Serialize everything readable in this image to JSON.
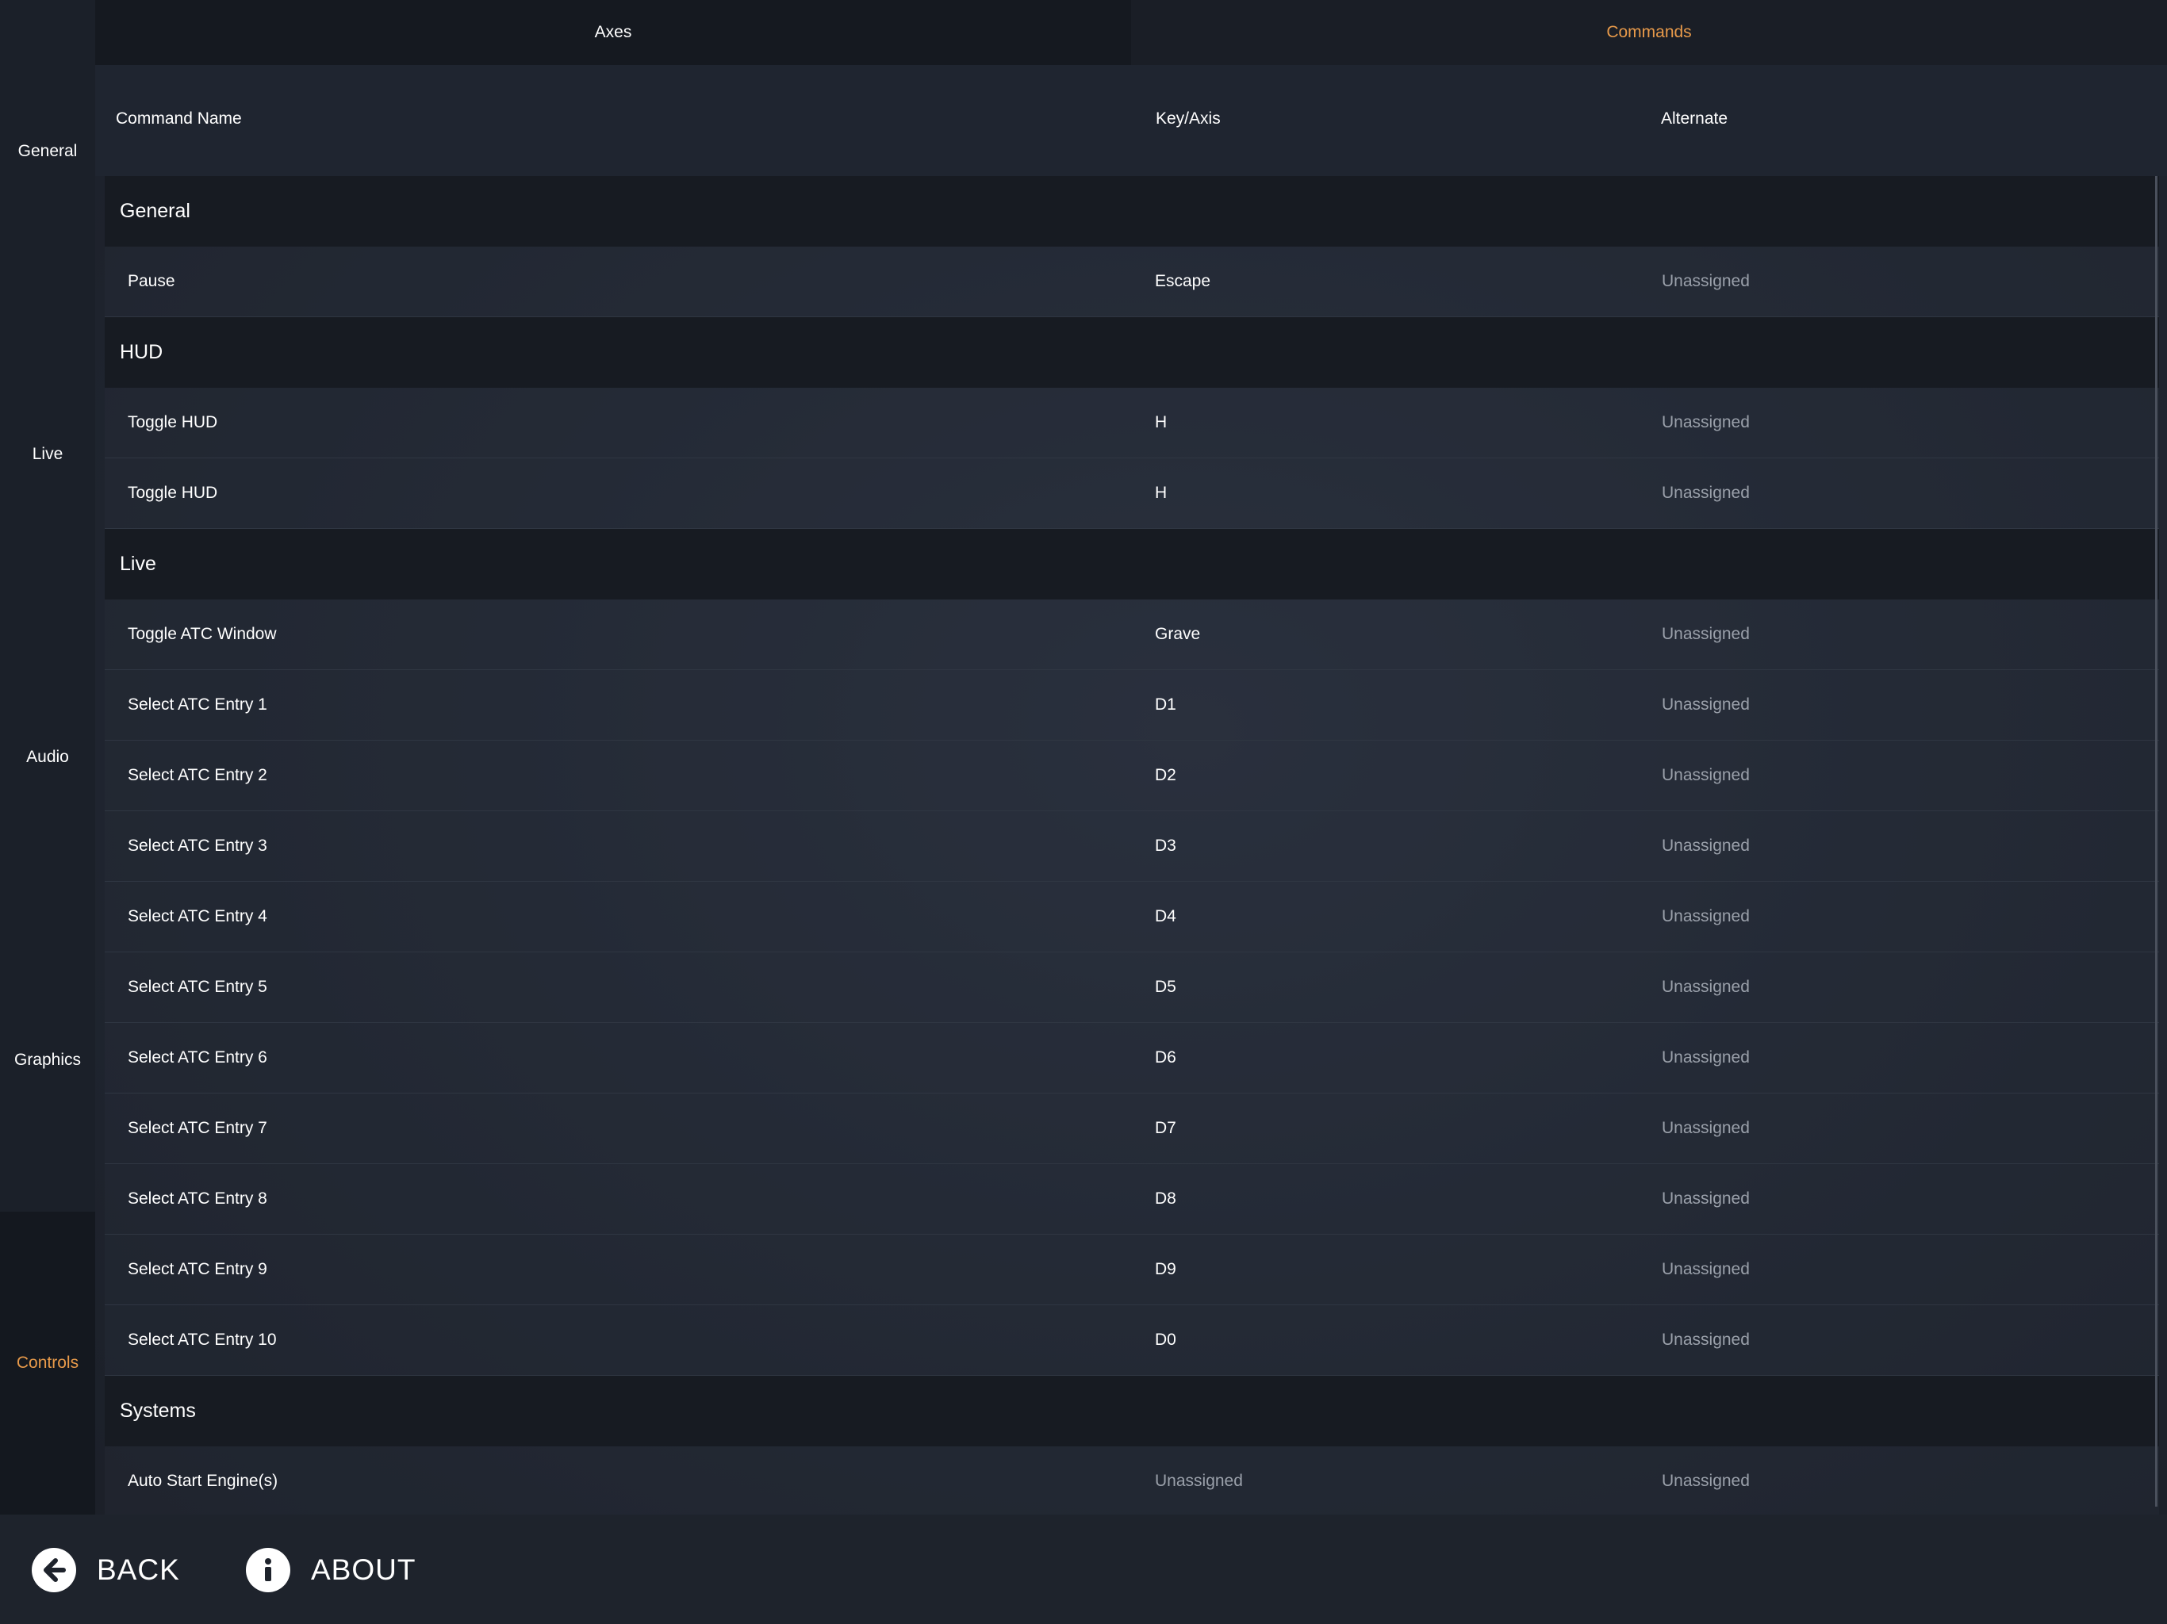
{
  "sidebar": {
    "items": [
      {
        "label": "General",
        "active": false
      },
      {
        "label": "Live",
        "active": false
      },
      {
        "label": "Audio",
        "active": false
      },
      {
        "label": "Graphics",
        "active": false
      },
      {
        "label": "Controls",
        "active": true
      }
    ]
  },
  "tabs": [
    {
      "label": "Axes",
      "active": false
    },
    {
      "label": "Commands",
      "active": true
    }
  ],
  "columns": {
    "name": "Command Name",
    "key": "Key/Axis",
    "alternate": "Alternate"
  },
  "sections": [
    {
      "title": "General",
      "rows": [
        {
          "name": "Pause",
          "key": "Escape",
          "alternate": "Unassigned"
        }
      ]
    },
    {
      "title": "HUD",
      "rows": [
        {
          "name": "Toggle HUD",
          "key": "H",
          "alternate": "Unassigned"
        },
        {
          "name": "Toggle HUD",
          "key": "H",
          "alternate": "Unassigned"
        }
      ]
    },
    {
      "title": "Live",
      "rows": [
        {
          "name": "Toggle ATC Window",
          "key": "Grave",
          "alternate": "Unassigned"
        },
        {
          "name": "Select ATC Entry 1",
          "key": "D1",
          "alternate": "Unassigned"
        },
        {
          "name": "Select ATC Entry 2",
          "key": "D2",
          "alternate": "Unassigned"
        },
        {
          "name": "Select ATC Entry 3",
          "key": "D3",
          "alternate": "Unassigned"
        },
        {
          "name": "Select ATC Entry 4",
          "key": "D4",
          "alternate": "Unassigned"
        },
        {
          "name": "Select ATC Entry 5",
          "key": "D5",
          "alternate": "Unassigned"
        },
        {
          "name": "Select ATC Entry 6",
          "key": "D6",
          "alternate": "Unassigned"
        },
        {
          "name": "Select ATC Entry 7",
          "key": "D7",
          "alternate": "Unassigned"
        },
        {
          "name": "Select ATC Entry 8",
          "key": "D8",
          "alternate": "Unassigned"
        },
        {
          "name": "Select ATC Entry 9",
          "key": "D9",
          "alternate": "Unassigned"
        },
        {
          "name": "Select ATC Entry 10",
          "key": "D0",
          "alternate": "Unassigned"
        }
      ]
    },
    {
      "title": "Systems",
      "rows": [
        {
          "name": "Auto Start Engine(s)",
          "key": "Unassigned",
          "alternate": "Unassigned"
        }
      ]
    }
  ],
  "footer": {
    "back_label": "BACK",
    "about_label": "ABOUT",
    "back_icon": "arrow-left-icon",
    "about_icon": "info-icon"
  },
  "colors": {
    "accent": "#e89a4a",
    "text": "#ffffff",
    "muted": "#9aa0aa"
  }
}
